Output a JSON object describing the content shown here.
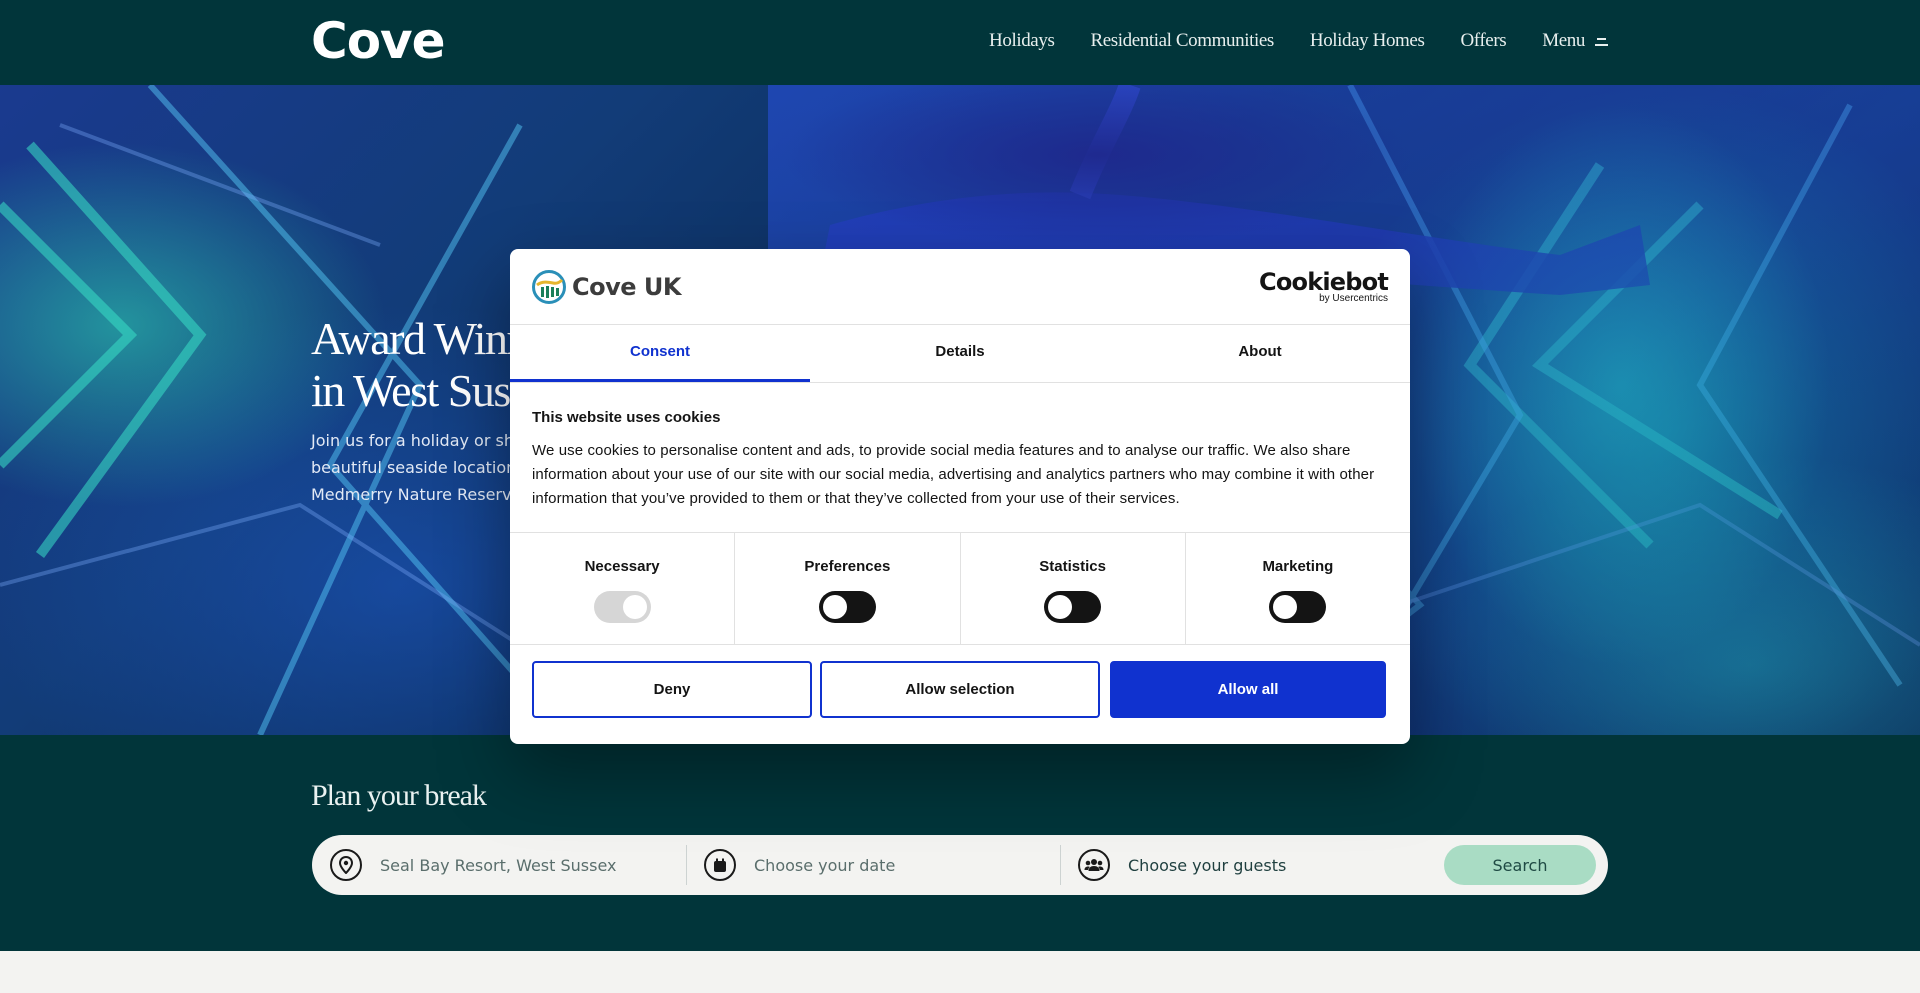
{
  "header": {
    "logo": "Cove",
    "nav": [
      "Holidays",
      "Residential Communities",
      "Holiday Homes",
      "Offers"
    ],
    "menu_label": "Menu"
  },
  "hero": {
    "title_line1": "Award Winnin",
    "title_line2": "in West Susse",
    "sub_line1": "Join us for a holiday or sho",
    "sub_line2": "beautiful seaside location",
    "sub_line3": "Medmerry Nature Reserve"
  },
  "plan": {
    "title": "Plan your break",
    "location": "Seal Bay Resort, West Sussex",
    "date_placeholder": "Choose your date",
    "guests_placeholder": "Choose your guests",
    "search_label": "Search",
    "location_icon": "map-pin-icon",
    "date_icon": "calendar-icon",
    "guests_icon": "guests-icon"
  },
  "cookie_dialog": {
    "brand": "Cove UK",
    "provider": "Cookiebot",
    "provider_sub": "by Usercentrics",
    "tabs": [
      "Consent",
      "Details",
      "About"
    ],
    "active_tab": "Consent",
    "title": "This website uses cookies",
    "text": "We use cookies to personalise content and ads, to provide social media features and to analyse our traffic. We also share information about your use of our site with our social media, advertising and analytics partners who may combine it with other information that you’ve provided to them or that they’ve collected from your use of their services.",
    "categories": [
      {
        "label": "Necessary",
        "state": "on",
        "disabled": true
      },
      {
        "label": "Preferences",
        "state": "off",
        "disabled": false
      },
      {
        "label": "Statistics",
        "state": "off",
        "disabled": false
      },
      {
        "label": "Marketing",
        "state": "off",
        "disabled": false
      }
    ],
    "buttons": {
      "deny": "Deny",
      "allow_selection": "Allow selection",
      "allow_all": "Allow all"
    },
    "accent_color": "#1032cf"
  },
  "colors": {
    "header_bg": "#01353a",
    "search_button": "#a9dcc4"
  }
}
